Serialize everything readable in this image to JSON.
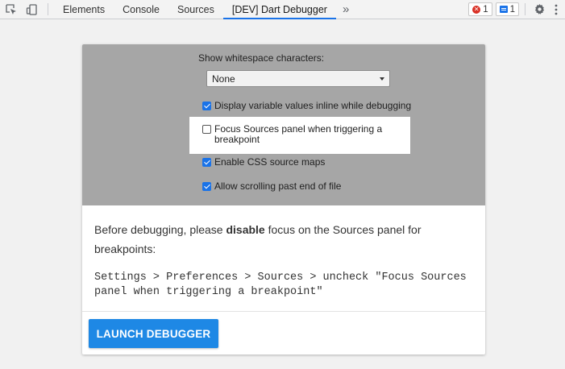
{
  "toolbar": {
    "icons": [
      "inspect-element-icon",
      "device-toolbar-icon",
      "more-tabs-icon",
      "settings-gear-icon",
      "more-options-icon"
    ],
    "tabs": [
      {
        "label": "Elements",
        "active": false
      },
      {
        "label": "Console",
        "active": false
      },
      {
        "label": "Sources",
        "active": false
      },
      {
        "label": "[DEV] Dart Debugger",
        "active": true
      }
    ],
    "overflow_glyph": "»",
    "error_count": "1",
    "issue_count": "1",
    "accent_color": "#1a73e8",
    "error_color": "#d93025"
  },
  "screenshot": {
    "whitespace_label": "Show whitespace characters:",
    "whitespace_select_value": "None",
    "options": [
      {
        "label": "Display variable values inline while debugging",
        "checked": true
      },
      {
        "label": "Focus Sources panel when triggering a breakpoint",
        "checked": false
      },
      {
        "label": "Enable CSS source maps",
        "checked": true
      },
      {
        "label": "Allow scrolling past end of file",
        "checked": true
      }
    ]
  },
  "instructions": {
    "pre": "Before debugging, please ",
    "emphasis": "disable",
    "post": " focus on the Sources panel for breakpoints:",
    "path": "Settings > Preferences > Sources > uncheck \"Focus Sources panel when triggering a breakpoint\""
  },
  "launch_button": {
    "label": "LAUNCH DEBUGGER",
    "color": "#1e88e5"
  }
}
